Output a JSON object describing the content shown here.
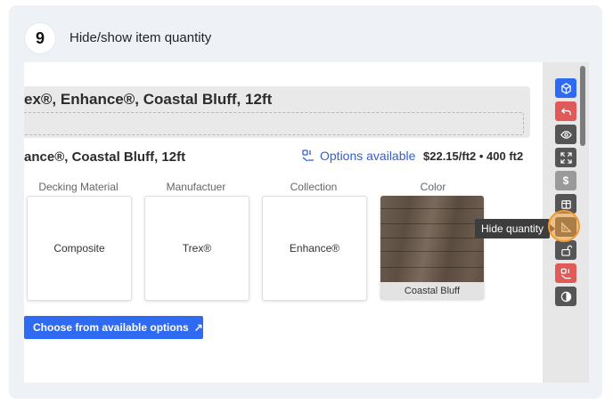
{
  "step": {
    "number": "9",
    "title": "Hide/show item quantity"
  },
  "screenshot": {
    "section_title": "ex®, Enhance®, Coastal Bluff, 12ft",
    "item_title": "ance®, Coastal Bluff, 12ft",
    "options_link": "Options available",
    "price": "$22.15/ft2 • 400 ft2",
    "attributes": [
      {
        "label": "Decking Material",
        "value": "Composite"
      },
      {
        "label": "Manufactuer",
        "value": "Trex®"
      },
      {
        "label": "Collection",
        "value": "Enhance®"
      },
      {
        "label": "Color",
        "value": "Coastal Bluff"
      }
    ],
    "choose_button": "Choose from available options",
    "tooltip": "Hide quantity"
  },
  "toolbar": [
    {
      "name": "cube-icon",
      "color": "#2f6bf2"
    },
    {
      "name": "undo-icon",
      "color": "#e05a5a"
    },
    {
      "name": "eye-icon",
      "color": "#555555"
    },
    {
      "name": "expand-icon",
      "color": "#555555"
    },
    {
      "name": "dollar-icon",
      "color": "#9a9a9a"
    },
    {
      "name": "box-3d-icon",
      "color": "#555555"
    },
    {
      "name": "ruler-icon",
      "color": "#555555"
    },
    {
      "name": "unlock-icon",
      "color": "#555555"
    },
    {
      "name": "options-icon",
      "color": "#e05a5a"
    },
    {
      "name": "contrast-icon",
      "color": "#555555"
    }
  ],
  "colors": {
    "accent": "#2f6bf2",
    "highlight": "#f29a2e",
    "danger": "#e05a5a"
  }
}
